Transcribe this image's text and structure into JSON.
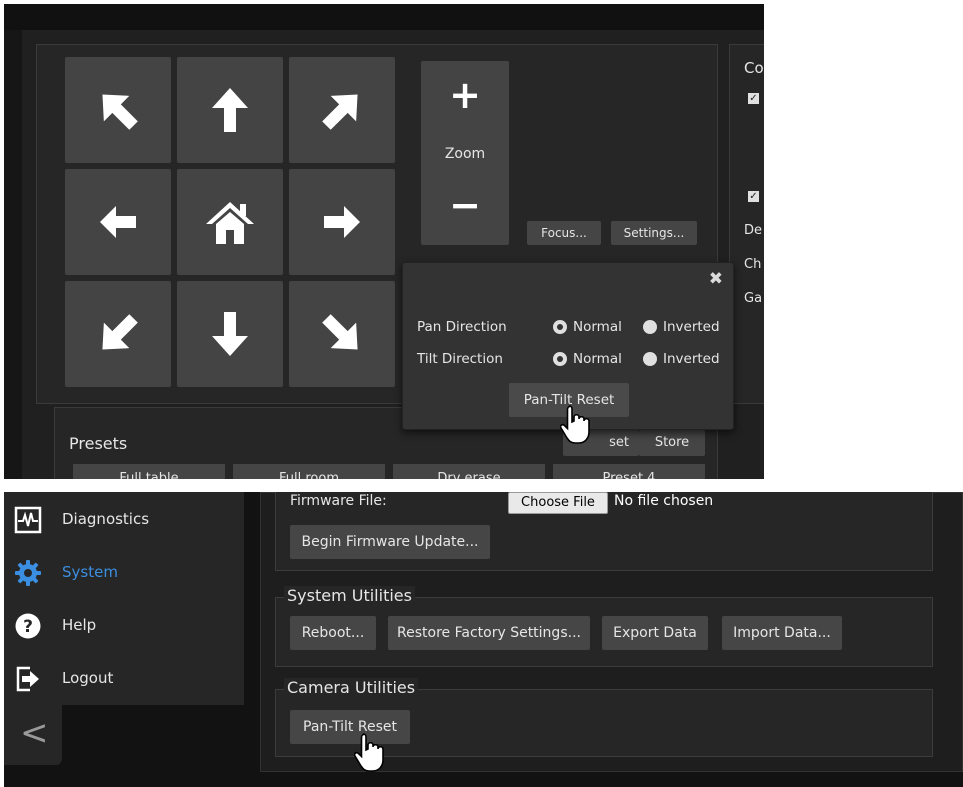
{
  "ptz": {
    "zoom_plus": "+",
    "zoom_label": "Zoom",
    "zoom_minus": "−",
    "focus_label": "Focus...",
    "settings_label": "Settings...",
    "directions": [
      "up-left",
      "up",
      "up-right",
      "left",
      "home",
      "right",
      "down-left",
      "down",
      "down-right"
    ]
  },
  "right_panel": {
    "heading": "Co",
    "labels": [
      "De",
      "Ch",
      "Ga"
    ]
  },
  "presets": {
    "title": "Presets",
    "reset_label": "set",
    "store_label": "Store",
    "items": [
      "Full table",
      "Full room",
      "Dry erase",
      "Preset 4"
    ]
  },
  "popup": {
    "close_icon": "close-icon",
    "pan_label": "Pan Direction",
    "tilt_label": "Tilt Direction",
    "normal_label": "Normal",
    "inverted_label": "Inverted",
    "pan_selected": "Normal",
    "tilt_selected": "Normal",
    "reset_label": "Pan-Tilt Reset"
  },
  "sidebar": {
    "items": [
      {
        "label": "Diagnostics",
        "icon": "diagnostics-icon"
      },
      {
        "label": "System",
        "icon": "gear-icon",
        "active": true
      },
      {
        "label": "Help",
        "icon": "help-icon"
      },
      {
        "label": "Logout",
        "icon": "logout-icon"
      }
    ],
    "collapse_glyph": "<"
  },
  "firmware": {
    "label": "Firmware File:",
    "choose_label": "Choose File",
    "no_file": "No file chosen",
    "begin_label": "Begin Firmware Update..."
  },
  "system_utilities": {
    "title": "System Utilities",
    "buttons": [
      "Reboot...",
      "Restore Factory Settings...",
      "Export Data",
      "Import Data..."
    ]
  },
  "camera_utilities": {
    "title": "Camera Utilities",
    "reset_label": "Pan-Tilt Reset"
  },
  "colors": {
    "accent": "#3b8fe0",
    "panel": "#262626",
    "button": "#454545"
  }
}
